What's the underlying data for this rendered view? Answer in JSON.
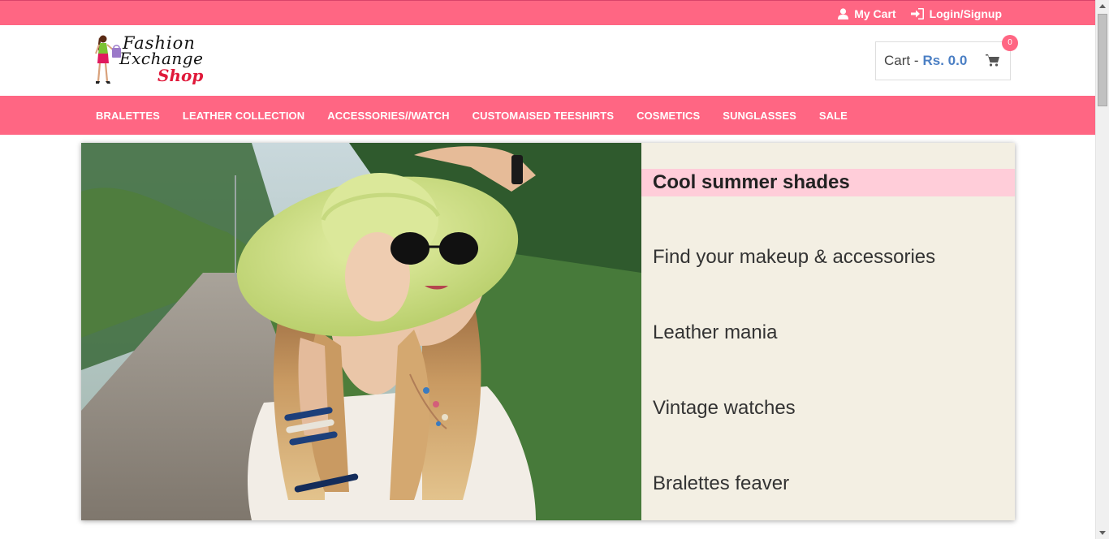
{
  "topbar": {
    "my_cart": "My Cart",
    "login": "Login/Signup"
  },
  "logo": {
    "line1": "Fashion",
    "line2": "Exchange",
    "line3": "Shop"
  },
  "cart": {
    "label": "Cart -",
    "amount": "Rs. 0.0",
    "count": "0"
  },
  "nav": {
    "items": [
      "BRALETTES",
      "LEATHER COLLECTION",
      "ACCESSORIES//WATCH",
      "CUSTOMAISED TEESHIRTS",
      "COSMETICS",
      "SUNGLASSES",
      "SALE"
    ]
  },
  "hero": {
    "items": [
      "Cool summer shades",
      "Find your makeup & accessories",
      "Leather mania",
      "Vintage watches",
      "Bralettes feaver"
    ],
    "active_index": 0
  },
  "colors": {
    "brand_pink": "#ff6683",
    "active_item_bg": "#ffcdd9",
    "side_panel_bg": "#f3efe3",
    "price_blue": "#4b7fc4"
  }
}
